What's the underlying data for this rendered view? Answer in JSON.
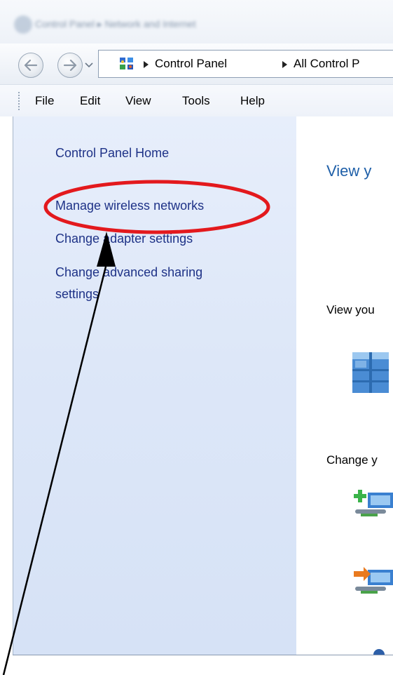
{
  "window": {
    "blurred_breadcrumb": "Control Panel ▸ Network and Internet"
  },
  "nav": {
    "back_icon": "back-arrow-icon",
    "forward_icon": "forward-arrow-icon",
    "recent_icon": "chevron-down-icon",
    "address": {
      "icon": "control-panel-icon",
      "crumbs": [
        "Control Panel",
        "All Control P"
      ]
    }
  },
  "menu": {
    "items": [
      "File",
      "Edit",
      "View",
      "Tools",
      "Help"
    ]
  },
  "sidebar": {
    "links": [
      "Control Panel Home",
      "Manage wireless networks",
      "Change adapter settings",
      "Change advanced sharing",
      "settings"
    ]
  },
  "content": {
    "title": "View y",
    "section1": "View you",
    "section2": "Change y",
    "icons": [
      "network-building-icon",
      "new-connection-icon",
      "connect-network-icon",
      "troubleshoot-icon"
    ]
  },
  "annotation": {
    "highlight_color": "#e3191d",
    "arrow_color": "#000000"
  }
}
